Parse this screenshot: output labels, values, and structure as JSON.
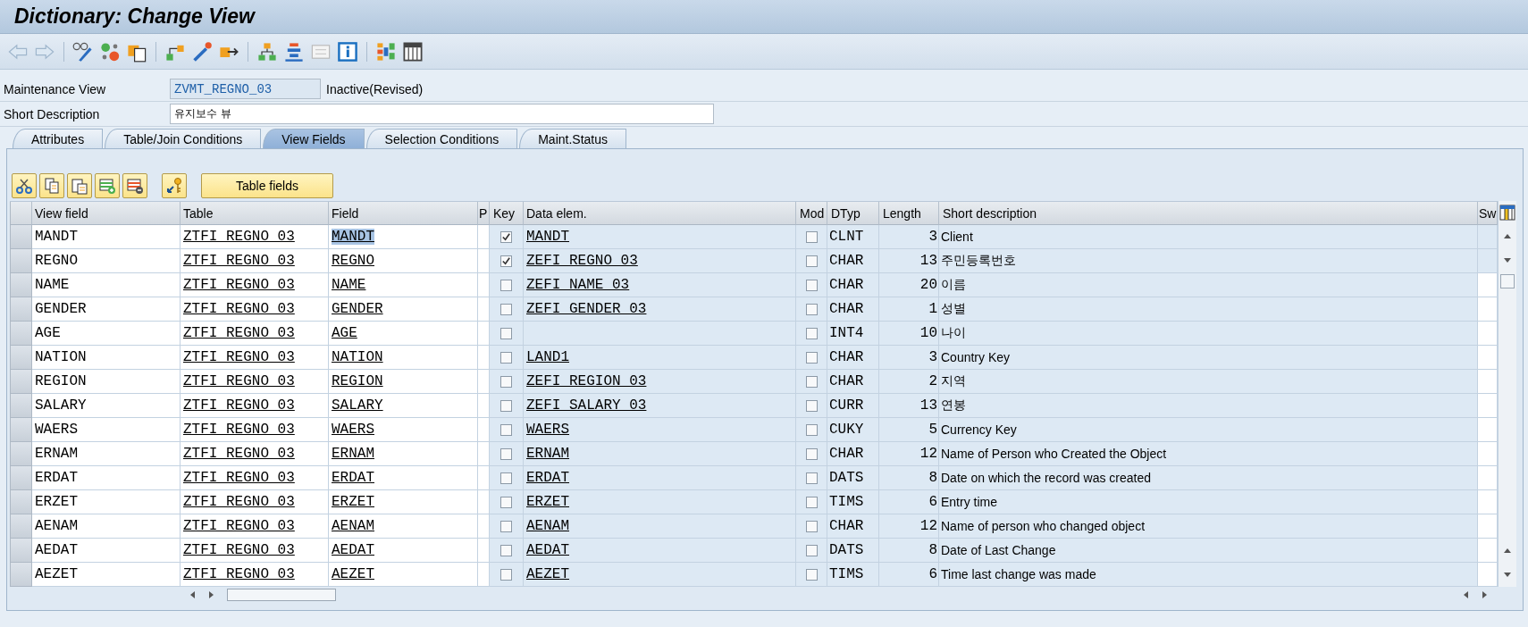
{
  "window": {
    "title": "Dictionary: Change View"
  },
  "header_fields": [
    {
      "kind": "readonly",
      "label": "Maintenance View",
      "value": "ZVMT_REGNO_03",
      "status": "Inactive(Revised)"
    },
    {
      "kind": "input",
      "label": "Short Description",
      "value": "유지보수 뷰"
    }
  ],
  "tabs": [
    {
      "label": "Attributes",
      "selected": false
    },
    {
      "label": "Table/Join Conditions",
      "selected": false
    },
    {
      "label": "View Fields",
      "selected": true
    },
    {
      "label": "Selection Conditions",
      "selected": false
    },
    {
      "label": "Maint.Status",
      "selected": false
    }
  ],
  "table_toolbar": {
    "button": "Table fields"
  },
  "table": {
    "columns": [
      "View field",
      "Table",
      "Field",
      "P",
      "Key",
      "Data elem.",
      "Mod",
      "DTyp",
      "Length",
      "Short description",
      "Sw"
    ],
    "rows": [
      {
        "view_field": "MANDT",
        "table": "ZTFI_REGNO_03",
        "field": "MANDT",
        "field_highlighted": true,
        "key": true,
        "data_element": "MANDT",
        "mod": false,
        "dtyp": "CLNT",
        "length": "3",
        "short_description": "Client"
      },
      {
        "view_field": "REGNO",
        "table": "ZTFI_REGNO_03",
        "field": "REGNO",
        "field_highlighted": false,
        "key": true,
        "data_element": "ZEFI_REGNO_03",
        "mod": false,
        "dtyp": "CHAR",
        "length": "13",
        "short_description": "주민등록번호"
      },
      {
        "view_field": "NAME",
        "table": "ZTFI_REGNO_03",
        "field": "NAME",
        "field_highlighted": false,
        "key": false,
        "data_element": "ZEFI_NAME_03",
        "mod": false,
        "dtyp": "CHAR",
        "length": "20",
        "short_description": "이름"
      },
      {
        "view_field": "GENDER",
        "table": "ZTFI_REGNO_03",
        "field": "GENDER",
        "field_highlighted": false,
        "key": false,
        "data_element": "ZEFI_GENDER_03",
        "mod": false,
        "dtyp": "CHAR",
        "length": "1",
        "short_description": "성별"
      },
      {
        "view_field": "AGE",
        "table": "ZTFI_REGNO_03",
        "field": "AGE",
        "field_highlighted": false,
        "key": false,
        "mod": false,
        "dtyp": "INT4",
        "length": "10",
        "short_description": "나이"
      },
      {
        "view_field": "NATION",
        "table": "ZTFI_REGNO_03",
        "field": "NATION",
        "field_highlighted": false,
        "key": false,
        "data_element": "LAND1",
        "mod": false,
        "dtyp": "CHAR",
        "length": "3",
        "short_description": "Country Key"
      },
      {
        "view_field": "REGION",
        "table": "ZTFI_REGNO_03",
        "field": "REGION",
        "field_highlighted": false,
        "key": false,
        "data_element": "ZEFI_REGION_03",
        "mod": false,
        "dtyp": "CHAR",
        "length": "2",
        "short_description": "지역"
      },
      {
        "view_field": "SALARY",
        "table": "ZTFI_REGNO_03",
        "field": "SALARY",
        "field_highlighted": false,
        "key": false,
        "data_element": "ZEFI_SALARY_03",
        "mod": false,
        "dtyp": "CURR",
        "length": "13",
        "short_description": "연봉"
      },
      {
        "view_field": "WAERS",
        "table": "ZTFI_REGNO_03",
        "field": "WAERS",
        "field_highlighted": false,
        "key": false,
        "data_element": "WAERS",
        "mod": false,
        "dtyp": "CUKY",
        "length": "5",
        "short_description": "Currency Key"
      },
      {
        "view_field": "ERNAM",
        "table": "ZTFI_REGNO_03",
        "field": "ERNAM",
        "field_highlighted": false,
        "key": false,
        "data_element": "ERNAM",
        "mod": false,
        "dtyp": "CHAR",
        "length": "12",
        "short_description": "Name of Person who Created the Object"
      },
      {
        "view_field": "ERDAT",
        "table": "ZTFI_REGNO_03",
        "field": "ERDAT",
        "field_highlighted": false,
        "key": false,
        "data_element": "ERDAT",
        "mod": false,
        "dtyp": "DATS",
        "length": "8",
        "short_description": "Date on which the record was created"
      },
      {
        "view_field": "ERZET",
        "table": "ZTFI_REGNO_03",
        "field": "ERZET",
        "field_highlighted": false,
        "key": false,
        "data_element": "ERZET",
        "mod": false,
        "dtyp": "TIMS",
        "length": "6",
        "short_description": "Entry time"
      },
      {
        "view_field": "AENAM",
        "table": "ZTFI_REGNO_03",
        "field": "AENAM",
        "field_highlighted": false,
        "key": false,
        "data_element": "AENAM",
        "mod": false,
        "dtyp": "CHAR",
        "length": "12",
        "short_description": "Name of person who changed object"
      },
      {
        "view_field": "AEDAT",
        "table": "ZTFI_REGNO_03",
        "field": "AEDAT",
        "field_highlighted": false,
        "key": false,
        "data_element": "AEDAT",
        "mod": false,
        "dtyp": "DATS",
        "length": "8",
        "short_description": "Date of Last Change"
      },
      {
        "view_field": "AEZET",
        "table": "ZTFI_REGNO_03",
        "field": "AEZET",
        "field_highlighted": false,
        "key": false,
        "data_element": "AEZET",
        "mod": false,
        "dtyp": "TIMS",
        "length": "6",
        "short_description": "Time last change was made"
      }
    ]
  }
}
